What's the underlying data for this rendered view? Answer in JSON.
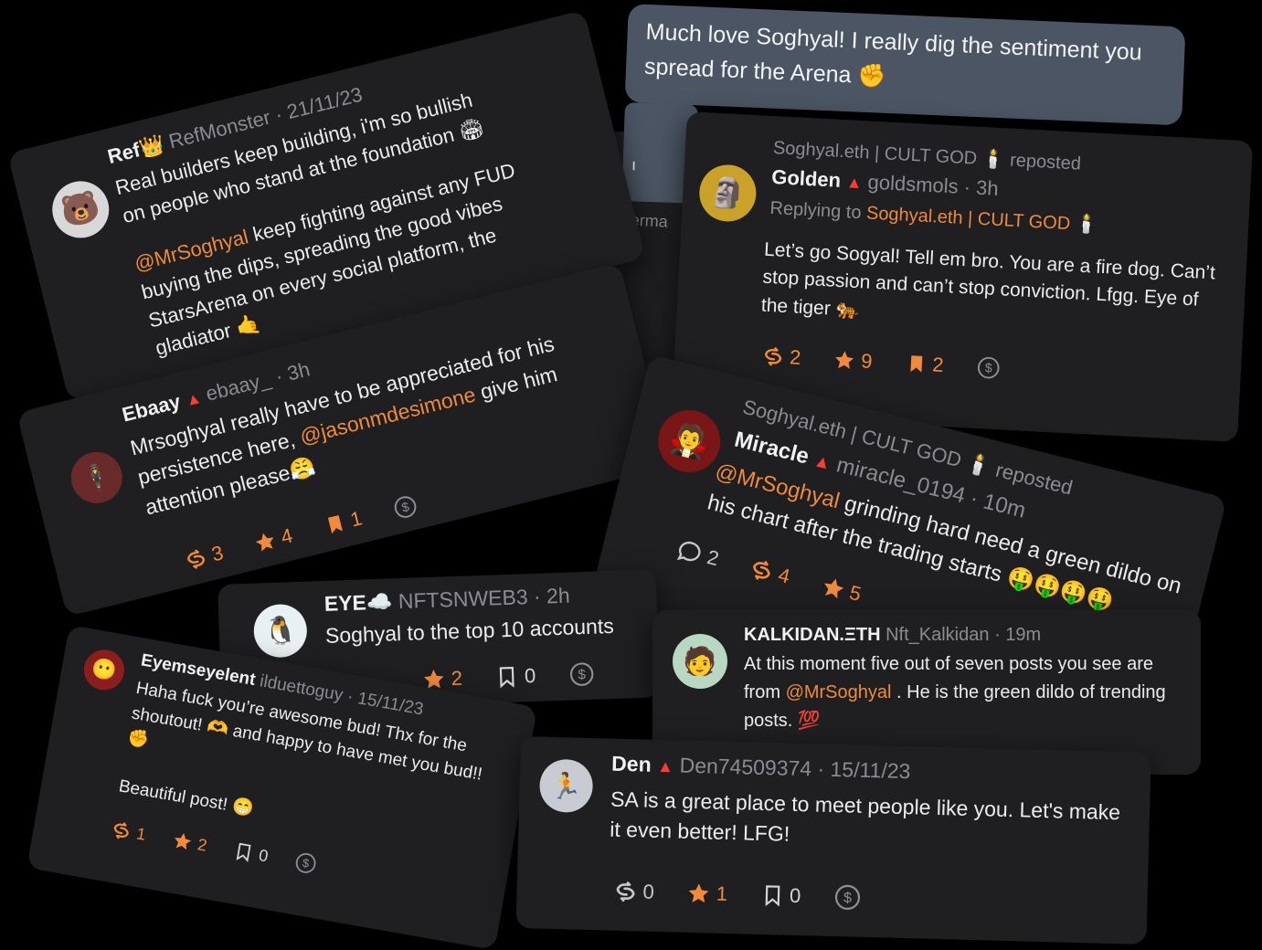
{
  "chat_bubble": {
    "text": "Much love Soghyal! I really dig the sentiment you spread for the Arena ✊"
  },
  "background_fragments": {
    "perma": "Perma",
    "cut_text": "ι"
  },
  "cards": {
    "ref": {
      "name": "Ref👑",
      "handle": "RefMonster",
      "time": "· 21/11/23",
      "p1": "Real builders keep building, i'm so bullish on people who stand at the foundation 🏟",
      "mention": "@MrSoghyal",
      "p2": " keep fighting against any FUD buying the dips, spreading the good vibes StarsArena on every social platform, the gladiator 🤙"
    },
    "ebaay": {
      "name": "Ebaay",
      "handle": "ebaay_",
      "time": "· 3h",
      "text1": "Mrsoghyal really have to be appreciated for his persistence here, ",
      "mention": "@jasonmdesimone",
      "text2": " give him attention please😤",
      "reposts": "3",
      "stars": "4",
      "bookmarks": "1"
    },
    "eye": {
      "name": "EYE☁️",
      "handle": "NFTSNWEB3",
      "time": "· 2h",
      "text": "Soghyal to the top 10 accounts",
      "stars": "2",
      "bookmarks": "0"
    },
    "eyem": {
      "name": "Eyemseyelent",
      "handle": "ilduettoguy",
      "time": "· 15/11/23",
      "p1": "Haha fuck you’re awesome bud! Thx for the shoutout! 🫶 and happy to have met you bud!! ✊",
      "p2": "Beautiful post! 😁",
      "reposts": "1",
      "stars": "2",
      "bookmarks": "0"
    },
    "golden": {
      "reposted_by": "Soghyal.eth | CULT GOD 🕯️",
      "reposted_word": "reposted",
      "name": "Golden",
      "handle": "goldsmols",
      "time": "· 3h",
      "replying_label": "Replying to",
      "replying_to": "Soghyal.eth | CULT GOD 🕯️",
      "text": "Let’s go Sogyal! Tell em bro. You are a fire dog. Can’t stop passion and can’t stop conviction. Lfgg. Eye of the tiger 🐅",
      "reposts": "2",
      "stars": "9",
      "bookmarks": "2"
    },
    "miracle": {
      "reposted_by": "Soghyal.eth | CULT GOD 🕯️",
      "reposted_word": "reposted",
      "name": "Miracle",
      "handle": "miracle_0194",
      "time": "· 10m",
      "mention": "@MrSoghyal",
      "text": " grinding hard need a green dildo on his chart after the trading starts 🤑🤑🤑🤑",
      "comments": "2",
      "reposts": "4",
      "stars": "5"
    },
    "kalkidan": {
      "name": "KALKIDAN.ΞTH",
      "handle": "Nft_Kalkidan",
      "time": "· 19m",
      "text1": "At this moment five out of seven posts you see are from ",
      "mention": "@MrSoghyal",
      "text2": " . He is the green dildo of trending posts. 💯"
    },
    "den": {
      "name": "Den",
      "handle": "Den74509374",
      "time": "· 15/11/23",
      "text": "SA is a great place to meet people like you. Let's make it even better! LFG!",
      "reposts": "0",
      "stars": "1",
      "bookmarks": "0"
    }
  },
  "colors": {
    "accent": "#f28a3a",
    "alert": "#ff3b2f",
    "card": "#1f1f22",
    "bubble": "#4b5563"
  }
}
